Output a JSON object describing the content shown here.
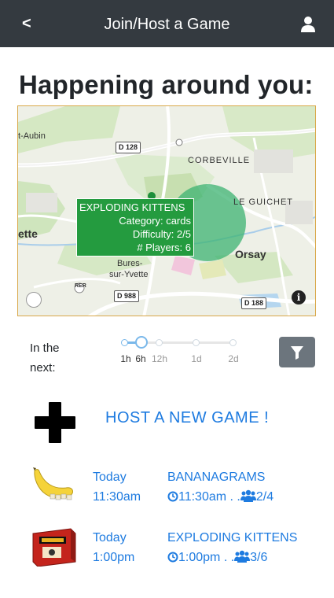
{
  "header": {
    "back_label": "<",
    "title": "Join/Host a Game",
    "user_icon": "user-icon"
  },
  "page": {
    "title": "Happening around you:"
  },
  "map": {
    "labels": {
      "place_aubin": "t-Aubin",
      "place_corbeville": "CORBEVILLE",
      "place_le_guichet": "LE GUICHET",
      "place_yvette": "ette",
      "place_bures": "Bures-",
      "place_sur_yvette": "sur-Yvette",
      "place_orsay": "Orsay",
      "rer": "RER"
    },
    "roads": [
      "D 128",
      "D 988",
      "D 188"
    ],
    "popup": {
      "title": "EXPLODING KITTENS",
      "category": "Category: cards",
      "difficulty": "Difficulty: 2/5",
      "players": "# Players: 6"
    },
    "info_label": "i",
    "colors": {
      "zone": "#3cb371",
      "popup": "#249b3f"
    }
  },
  "time_filter": {
    "label": "In the next:",
    "ticks": [
      "1h",
      "6h",
      "12h",
      "1d",
      "2d"
    ],
    "selected": "6h"
  },
  "filter_button": {
    "icon": "filter-icon"
  },
  "host": {
    "icon": "plus-icon",
    "label": "HOST A NEW GAME !"
  },
  "games": [
    {
      "icon": "bananagrams-image",
      "day": "Today",
      "time": "11:30am",
      "name": "BANANAGRAMS",
      "start": "11:30am . .",
      "players": "2/4"
    },
    {
      "icon": "exploding-kittens-image",
      "day": "Today",
      "time": "1:00pm",
      "name": "EXPLODING KITTENS",
      "start": "1:00pm . .",
      "players": "3/6"
    }
  ],
  "accent_color": "#1e7be0"
}
